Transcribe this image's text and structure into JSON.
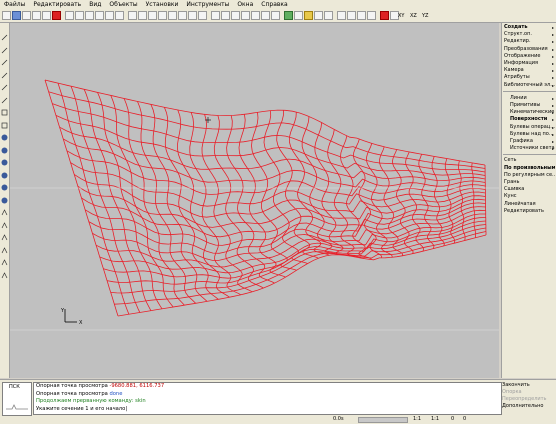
{
  "menu": [
    "Файлы",
    "Редактировать",
    "Вид",
    "Объекты",
    "Установки",
    "Инструменты",
    "Окна",
    "Справка"
  ],
  "toolbar_text": [
    "XY",
    "XZ",
    "YZ"
  ],
  "right_panel": {
    "top_items": [
      {
        "label": "Создать",
        "bold": true
      },
      {
        "label": "Структ.оп.",
        "bold": false
      },
      {
        "label": "Редактир.",
        "bold": false
      },
      {
        "label": "Преобразования",
        "bold": false
      },
      {
        "label": "Отображение",
        "bold": false
      },
      {
        "label": "Информация",
        "bold": false
      },
      {
        "label": "Камера",
        "bold": false
      },
      {
        "label": "Атрибуты",
        "bold": false
      },
      {
        "label": "Библиотечный эл...",
        "bold": false
      }
    ],
    "mid_items": [
      {
        "label": "Линии",
        "bold": false
      },
      {
        "label": "Примитивы",
        "bold": false
      },
      {
        "label": "Кинематические",
        "bold": false
      },
      {
        "label": "Поверхности",
        "bold": true
      },
      {
        "label": "Булевы операц...",
        "bold": false
      },
      {
        "label": "Булевы над по...",
        "bold": false
      },
      {
        "label": "Графика",
        "bold": false
      },
      {
        "label": "Источники света",
        "bold": false
      }
    ],
    "low_items": [
      {
        "label": "Сеть",
        "bold": false
      },
      {
        "label": "По произвольным...",
        "bold": true
      },
      {
        "label": "По регулярным се...",
        "bold": false
      },
      {
        "label": "Грань",
        "bold": false
      },
      {
        "label": "Сшивка",
        "bold": false
      },
      {
        "label": "Кунс",
        "bold": false
      },
      {
        "label": "Линейчатая",
        "bold": false
      },
      {
        "label": "Редактировать",
        "bold": false
      }
    ]
  },
  "layer": {
    "label": "ПСК"
  },
  "cmdlog": [
    {
      "prefix": "Опорная точка просмотра ",
      "value": "-9680.881, 6116.737"
    },
    {
      "prefix": "Опорная точка просмотра ",
      "value": "done"
    },
    {
      "prefix": "Продолжаем прерванную команду: ",
      "value": "skin"
    },
    {
      "prefix": "Укажите сечение 1 и его начало",
      "value": ""
    }
  ],
  "status": {
    "zoom": "0.0s",
    "a": "1:1",
    "b": "1:1",
    "c": "0",
    "d": "0"
  },
  "bottom_right": [
    {
      "label": "Закончить",
      "grey": false
    },
    {
      "label": "Опорка",
      "grey": true
    },
    {
      "label": "Переопределить",
      "grey": true
    },
    {
      "label": "Дополнительно",
      "grey": false
    }
  ],
  "colors": {
    "wire": "#e8202a",
    "viewport": "#c0c0c0",
    "chrome": "#ece9d8"
  },
  "axis_labels": {
    "y": "Y",
    "x": "X"
  }
}
